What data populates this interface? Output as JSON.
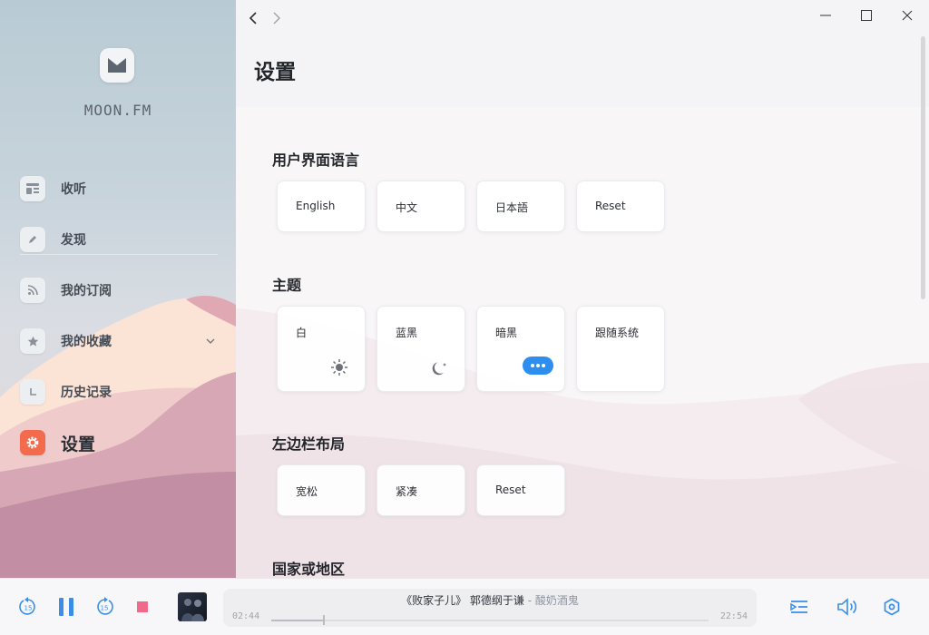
{
  "app": {
    "brand": "MOON.FM"
  },
  "sidebar": {
    "items": [
      {
        "label": "收听",
        "icon": "listen-icon"
      },
      {
        "label": "发现",
        "icon": "pencil-icon"
      },
      {
        "label": "我的订阅",
        "icon": "rss-icon"
      },
      {
        "label": "我的收藏",
        "icon": "star-icon",
        "expandable": true
      },
      {
        "label": "历史记录",
        "icon": "clock-icon"
      },
      {
        "label": "设置",
        "icon": "gear-icon",
        "active": true
      }
    ]
  },
  "page": {
    "title": "设置",
    "sections": [
      {
        "title": "用户界面语言",
        "options": [
          "English",
          "中文",
          "日本語",
          "Reset"
        ]
      },
      {
        "title": "主题",
        "options": [
          "白",
          "蓝黑",
          "暗黑",
          "跟随系统"
        ],
        "option_icons": [
          "sun-icon",
          "moon-icon",
          "more-icon",
          ""
        ]
      },
      {
        "title": "左边栏布局",
        "options": [
          "宽松",
          "紧凑",
          "Reset"
        ]
      },
      {
        "title": "国家或地区",
        "options": []
      }
    ]
  },
  "player": {
    "title": "《败家子儿》 郭德纲于谦",
    "artist": "- 酸奶酒鬼",
    "elapsed": "02:44",
    "duration": "22:54",
    "progress": 0.12,
    "rewind_label": "15",
    "forward_label": "15",
    "accent": "#3a8ee6",
    "stop_color": "#f06b8a"
  },
  "colors": {
    "active_nav": "#f36b4d",
    "accent_blue": "#2d8ef0"
  }
}
